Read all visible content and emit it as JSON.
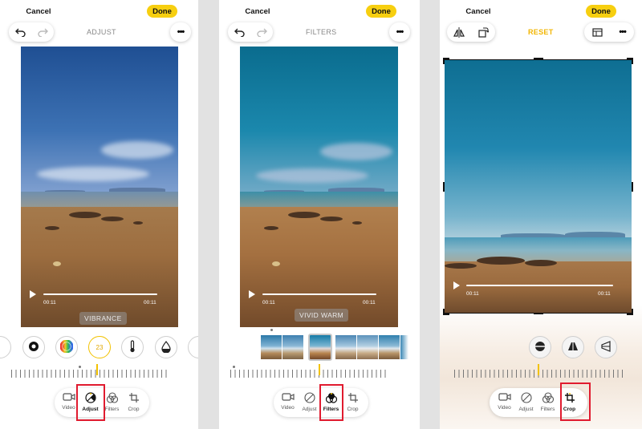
{
  "panel_adjust": {
    "cancel": "Cancel",
    "done": "Done",
    "title": "ADJUST",
    "time_left": "00:11",
    "time_right": "00:11",
    "overlay_label": "VIBRANCE",
    "selected_value": "23",
    "tabs": [
      {
        "label": "Video",
        "icon": "video-icon"
      },
      {
        "label": "Adjust",
        "icon": "adjust-icon"
      },
      {
        "label": "Filters",
        "icon": "filters-icon"
      },
      {
        "label": "Crop",
        "icon": "crop-icon"
      }
    ],
    "selected_tab": "Adjust"
  },
  "panel_filters": {
    "cancel": "Cancel",
    "done": "Done",
    "title": "FILTERS",
    "time_left": "00:11",
    "time_right": "00:11",
    "overlay_label": "VIVID WARM",
    "tabs": [
      {
        "label": "Video",
        "icon": "video-icon"
      },
      {
        "label": "Adjust",
        "icon": "adjust-icon"
      },
      {
        "label": "Filters",
        "icon": "filters-icon"
      },
      {
        "label": "Crop",
        "icon": "crop-icon"
      }
    ],
    "selected_tab": "Filters"
  },
  "panel_crop": {
    "cancel": "Cancel",
    "done": "Done",
    "title": "RESET",
    "time_left": "00:11",
    "time_right": "00:11",
    "tabs": [
      {
        "label": "Video",
        "icon": "video-icon"
      },
      {
        "label": "Adjust",
        "icon": "adjust-icon"
      },
      {
        "label": "Filters",
        "icon": "filters-icon"
      },
      {
        "label": "Crop",
        "icon": "crop-icon"
      }
    ],
    "selected_tab": "Crop"
  },
  "colors": {
    "accent_yellow": "#f7cf10",
    "highlight_red": "#e01b2f"
  }
}
